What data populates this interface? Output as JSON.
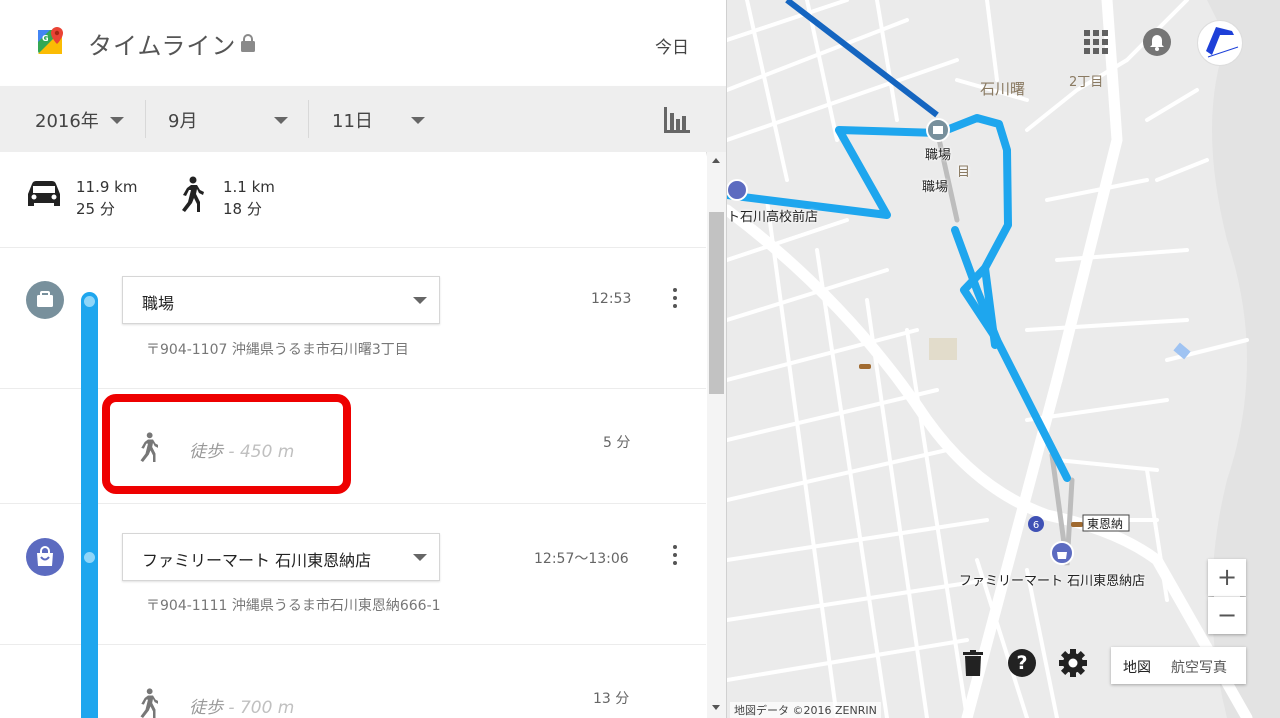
{
  "header": {
    "title": "タイムライン",
    "today_label": "今日"
  },
  "date_selector": {
    "year": "2016年",
    "month": "9月",
    "day": "11日"
  },
  "summary": {
    "car": {
      "distance": "11.9 km",
      "duration": "25 分"
    },
    "walk": {
      "distance": "1.1 km",
      "duration": "18 分"
    }
  },
  "timeline": {
    "place1": {
      "name": "職場",
      "time": "12:53",
      "address": "〒904-1107 沖縄県うるま市石川曙3丁目"
    },
    "walk1": {
      "label": "徒歩",
      "distance": "- 450 m",
      "duration": "5 分"
    },
    "place2": {
      "name": "ファミリーマート 石川東恩納店",
      "time": "12:57〜13:06",
      "address": "〒904-1111 沖縄県うるま市石川東恩納666-1"
    },
    "walk2": {
      "label": "徒歩",
      "distance": "- 700 m",
      "duration": "13 分"
    }
  },
  "map": {
    "labels": {
      "area1": "石川曙",
      "area2": "2丁目",
      "work1": "職場",
      "work2": "職場",
      "moku": "目",
      "store_left": "ト石川高校前店",
      "store_main": "ファミリーマート 石川東恩納店",
      "station": "東恩納",
      "route_no": "6"
    },
    "maptype": {
      "map": "地図",
      "satellite": "航空写真"
    },
    "zoom": {
      "in": "+",
      "out": "−"
    },
    "copyright": "地図データ ©2016 ZENRIN",
    "help": "?",
    "route_color": "#1ea6ee"
  },
  "colors": {
    "accent": "#1ea6ee",
    "highlight": "#ee0000",
    "work_icon": "#78909c",
    "store_icon": "#5c6bc0"
  }
}
